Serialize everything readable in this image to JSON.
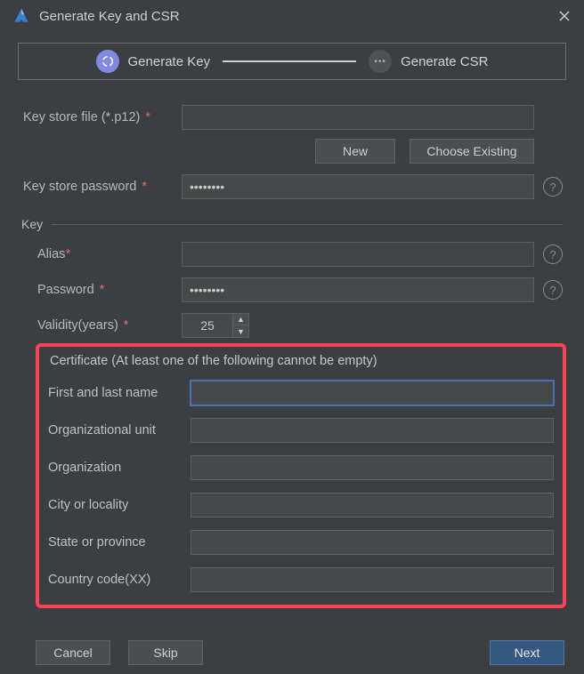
{
  "title": "Generate Key and CSR",
  "stepper": {
    "step1": "Generate Key",
    "step2": "Generate CSR"
  },
  "labels": {
    "keystoreFile": "Key store file (*.p12)",
    "new": "New",
    "chooseExisting": "Choose Existing",
    "keystorePassword": "Key store password",
    "keySection": "Key",
    "alias": "Alias",
    "password": "Password",
    "validity": "Validity(years)"
  },
  "values": {
    "keystoreFile": "",
    "keystorePassword": "••••••••",
    "alias": "",
    "password": "••••••••",
    "validity": "25"
  },
  "cert": {
    "title": "Certificate (At least one of the following cannot be empty)",
    "firstLast": "First and last name",
    "orgUnit": "Organizational unit",
    "org": "Organization",
    "city": "City or locality",
    "state": "State or province",
    "country": "Country code(XX)"
  },
  "certValues": {
    "firstLast": "",
    "orgUnit": "",
    "org": "",
    "city": "",
    "state": "",
    "country": ""
  },
  "footer": {
    "cancel": "Cancel",
    "skip": "Skip",
    "next": "Next"
  }
}
